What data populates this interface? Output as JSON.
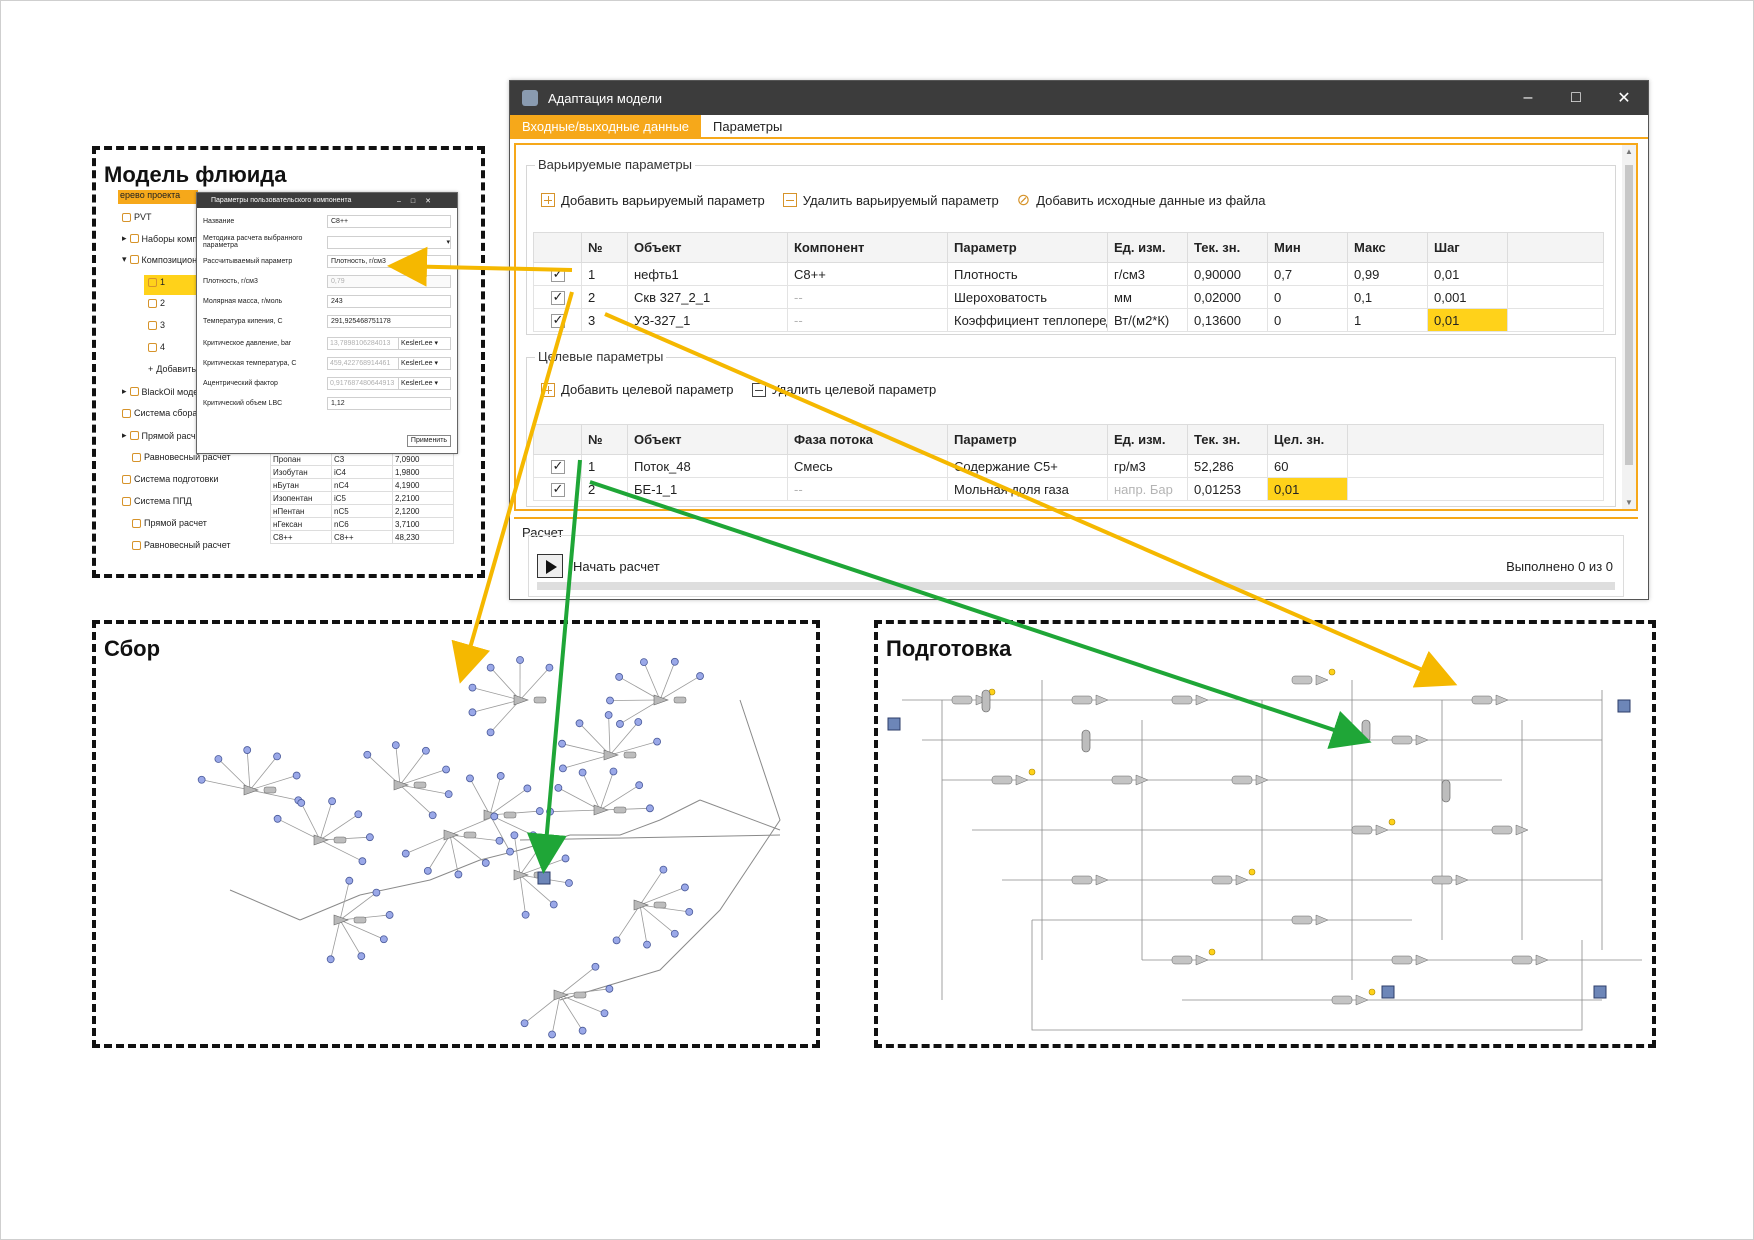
{
  "panels": {
    "fluid": "Модель флюида",
    "collection": "Сбор",
    "preparation": "Подготовка"
  },
  "window": {
    "title": "Адаптация модели",
    "tabs": [
      "Входные/выходные данные",
      "Параметры"
    ],
    "varied": {
      "legend": "Варьируемые параметры",
      "add": "Добавить варьируемый параметр",
      "remove": "Удалить варьируемый параметр",
      "add_file": "Добавить исходные данные из файла",
      "headers": [
        "№",
        "Объект",
        "Компонент",
        "Параметр",
        "Ед. изм.",
        "Тек. зн.",
        "Мин",
        "Макс",
        "Шаг"
      ],
      "rows": [
        {
          "checked": true,
          "cells": [
            "1",
            "нефть1",
            "C8++",
            "Плотность",
            "г/см3",
            "0,90000",
            "0,7",
            "0,99",
            "0,01"
          ]
        },
        {
          "checked": true,
          "cells": [
            "2",
            "Скв 327_2_1",
            "--",
            "Шероховатость",
            "мм",
            "0,02000",
            "0",
            "0,1",
            "0,001"
          ]
        },
        {
          "checked": true,
          "cells": [
            "3",
            "УЗ-327_1",
            "--",
            "Коэффициент теплоперед",
            "Вт/(м2*К)",
            "0,13600",
            "0",
            "1",
            "0,01"
          ]
        }
      ]
    },
    "target": {
      "legend": "Целевые параметры",
      "add": "Добавить целевой параметр",
      "remove": "Удалить целевой параметр",
      "headers": [
        "№",
        "Объект",
        "Фаза потока",
        "Параметр",
        "Ед. изм.",
        "Тек. зн.",
        "Цел. зн."
      ],
      "rows": [
        {
          "checked": true,
          "cells": [
            "1",
            "Поток_48",
            "Смесь",
            "Содержание С5+",
            "гр/м3",
            "52,286",
            "60"
          ]
        },
        {
          "checked": true,
          "cells": [
            "2",
            "БЕ-1_1",
            "--",
            "Мольная доля газа",
            "напр. Бар",
            "0,01253",
            "0,01"
          ]
        }
      ]
    },
    "calc": {
      "legend": "Расчет",
      "start": "Начать расчет",
      "done": "Выполнено 0 из 0",
      "progress": 0
    }
  },
  "fluid": {
    "tree_header": "ерево проекта",
    "tree": [
      "PVT",
      "Наборы комп",
      "Композицион",
      "1",
      "2",
      "3",
      "4",
      "Добавить",
      "BlackOil моде",
      "Система сбора",
      "Прямой расч",
      "Равновесный расчет",
      "Система подготовки",
      "Система ППД",
      "Прямой расчет",
      "Равновесный расчет"
    ],
    "components": [
      [
        "Пропан",
        "C3",
        "7,0900"
      ],
      [
        "Изобутан",
        "iC4",
        "1,9800"
      ],
      [
        "нБутан",
        "nC4",
        "4,1900"
      ],
      [
        "Изопентан",
        "iC5",
        "2,2100"
      ],
      [
        "нПентан",
        "nC5",
        "2,1200"
      ],
      [
        "нГексан",
        "nC6",
        "3,7100"
      ],
      [
        "C8++",
        "C8++",
        "48,230"
      ]
    ],
    "dialog": {
      "title": "Параметры пользовательского компонента",
      "rows": [
        {
          "label": "Название",
          "value": "C8++"
        },
        {
          "label": "Методика расчета выбранного параметра",
          "value": ""
        },
        {
          "label": "Рассчитываемый параметр",
          "value": "Плотность, г/см3"
        },
        {
          "label": "Плотность, г/см3",
          "value": "0,79"
        },
        {
          "label": "Молярная масса, г/моль",
          "value": "243"
        },
        {
          "label": "Температура кипения, С",
          "value": "291,925468751178"
        },
        {
          "label": "Критическое давление, bar",
          "value": "13,7898106284013",
          "method": "KeslerLee"
        },
        {
          "label": "Критическая температура, С",
          "value": "459,422768914461",
          "method": "KeslerLee"
        },
        {
          "label": "Ацентрический фактор",
          "value": "0,917687480644913",
          "method": "KeslerLee"
        },
        {
          "label": "Критический объем LBC",
          "value": "1,12"
        }
      ],
      "apply": "Применить"
    }
  },
  "colors": {
    "accent": "#f6a81a",
    "highlight": "#ffd21a",
    "arrow_yellow": "#f5b800",
    "arrow_green": "#1fa637",
    "titlebar": "#3c3c3c"
  },
  "icons": [
    "app-icon",
    "plus-icon",
    "minus-icon",
    "paperclip-icon",
    "play-icon",
    "checkbox-icon",
    "minimize-icon",
    "maximize-icon",
    "close-icon"
  ]
}
